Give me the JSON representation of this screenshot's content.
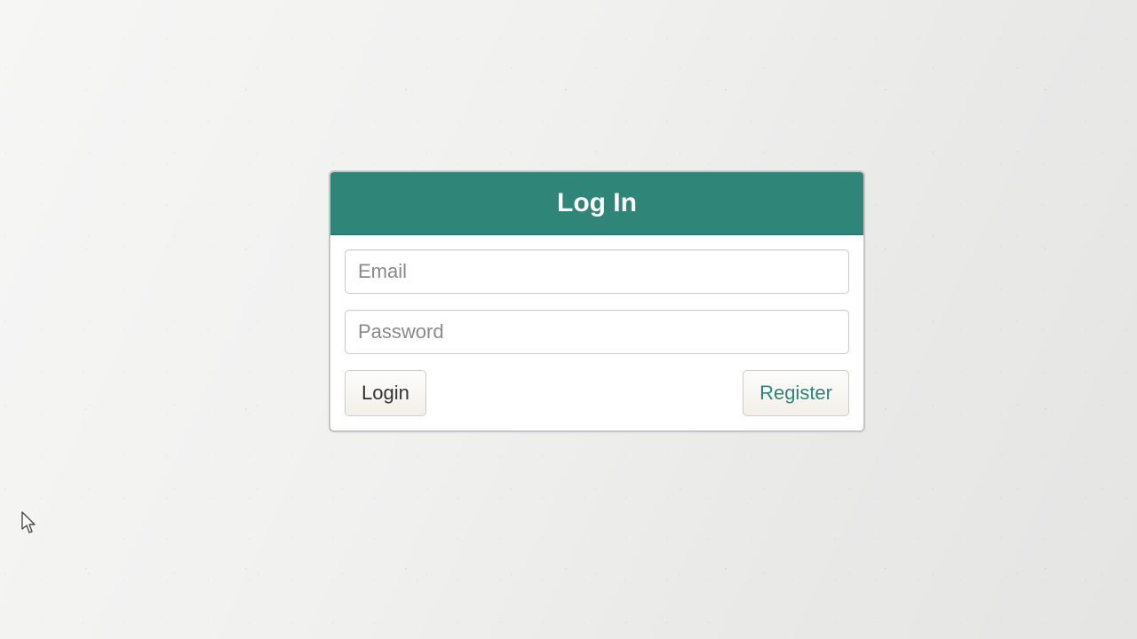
{
  "panel": {
    "title": "Log In",
    "email_placeholder": "Email",
    "email_value": "",
    "password_placeholder": "Password",
    "password_value": "",
    "login_label": "Login",
    "register_label": "Register"
  },
  "colors": {
    "header_bg": "#2e8578",
    "register_text": "#2e8578",
    "panel_border": "#c5c5c5"
  }
}
